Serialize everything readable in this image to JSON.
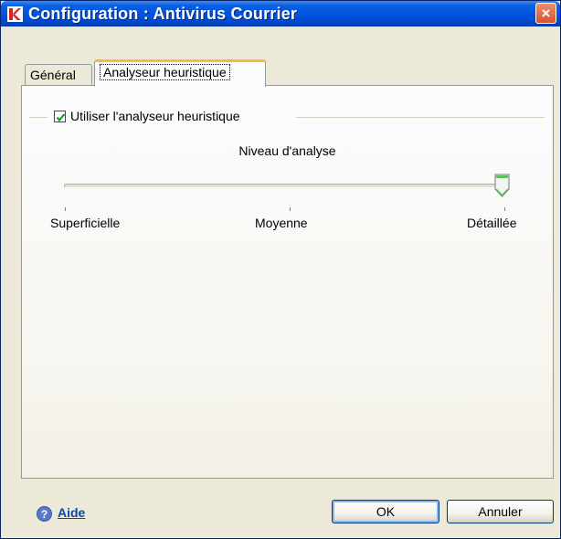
{
  "window": {
    "title": "Configuration : Antivirus Courrier",
    "close_glyph": "×"
  },
  "tabs": [
    {
      "label": "Général",
      "selected": false
    },
    {
      "label": "Analyseur heuristique",
      "selected": true
    }
  ],
  "heuristic": {
    "enable_label": "Utiliser l'analyseur heuristique",
    "enabled": true,
    "level_title": "Niveau d'analyse",
    "levels": [
      "Superficielle",
      "Moyenne",
      "Détaillée"
    ],
    "selected_level": "Détaillée"
  },
  "footer": {
    "help_label": "Aide",
    "ok_label": "OK",
    "cancel_label": "Annuler"
  },
  "colors": {
    "titlebar": "#0054e3",
    "close_button": "#d9532b",
    "selected_tab_accent": "#f7b83f",
    "help_link": "#0c47a6"
  },
  "icons": {
    "app": "kaspersky-k-icon",
    "help": "question-circle-icon",
    "close": "close-icon"
  }
}
